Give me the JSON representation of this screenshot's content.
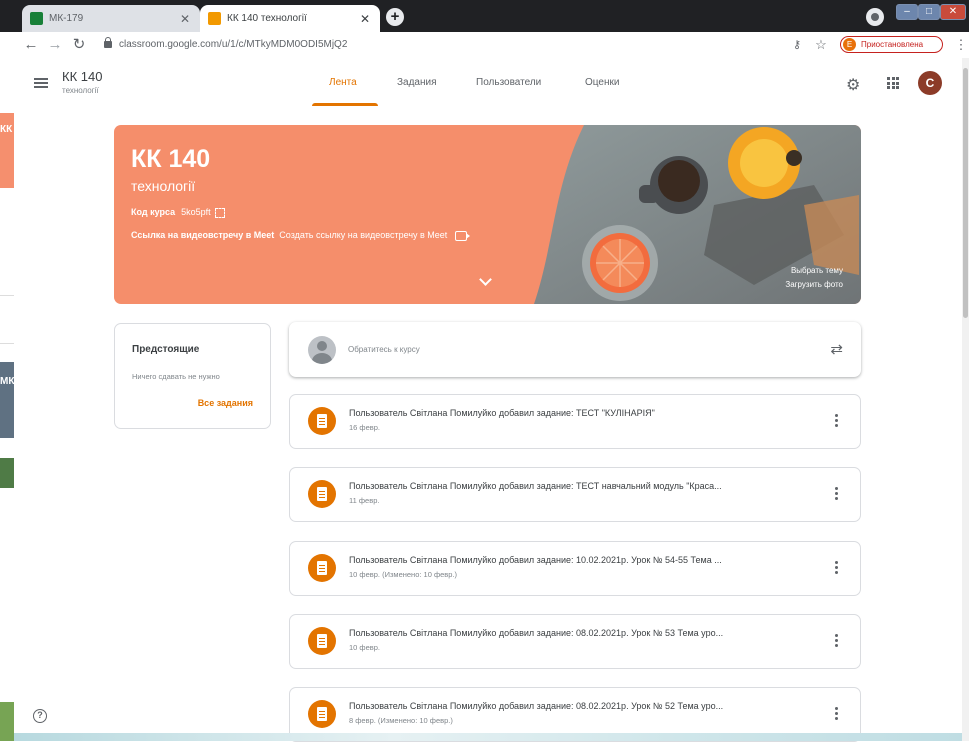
{
  "browser": {
    "tabs": [
      {
        "title": "МК-179",
        "active": false
      },
      {
        "title": "КК 140 технології",
        "active": true
      }
    ],
    "url": "classroom.google.com/u/1/c/MTkyMDM0ODI5MjQ2",
    "profile_initial": "E",
    "profile_status": "Приостановлена"
  },
  "header": {
    "course_name": "КК 140",
    "course_subtitle": "технології",
    "tabs": [
      "Лента",
      "Задания",
      "Пользователи",
      "Оценки"
    ],
    "active_tab": "Лента",
    "user_initial": "C"
  },
  "banner": {
    "title": "КК 140",
    "subtitle": "технології",
    "code_label": "Код курса",
    "code_value": "5ko5pft",
    "meet_label": "Ссылка на видеовстречу в Meet",
    "meet_create": "Создать ссылку на видеовстречу в Meet",
    "select_theme": "Выбрать тему",
    "upload_photo": "Загрузить фото"
  },
  "upcoming": {
    "title": "Предстоящие",
    "empty": "Ничего сдавать не нужно",
    "all_link": "Все задания"
  },
  "announce": {
    "placeholder": "Обратитесь к курсу"
  },
  "stream": [
    {
      "title": "Пользователь Світлана Помилуйко добавил задание: ТЕСТ \"КУЛІНАРІЯ\"",
      "date": "16 февр."
    },
    {
      "title": "Пользователь Світлана Помилуйко добавил задание: ТЕСТ навчальний модуль \"Краса...",
      "date": "11 февр."
    },
    {
      "title": "Пользователь Світлана Помилуйко добавил задание: 10.02.2021р. Урок № 54-55 Тема ...",
      "date": "10 февр. (Изменено: 10 февр.)"
    },
    {
      "title": "Пользователь Світлана Помилуйко добавил задание: 08.02.2021р. Урок № 53 Тема уро...",
      "date": "10 февр."
    },
    {
      "title": "Пользователь Світлана Помилуйко добавил задание: 08.02.2021р. Урок № 52 Тема уро...",
      "date": "8 февр. (Изменено: 10 февр.)"
    }
  ],
  "fragments": {
    "orange": "КК",
    "gray": "МК"
  },
  "colors": {
    "accent": "#e37400",
    "banner": "#f58e6b"
  }
}
